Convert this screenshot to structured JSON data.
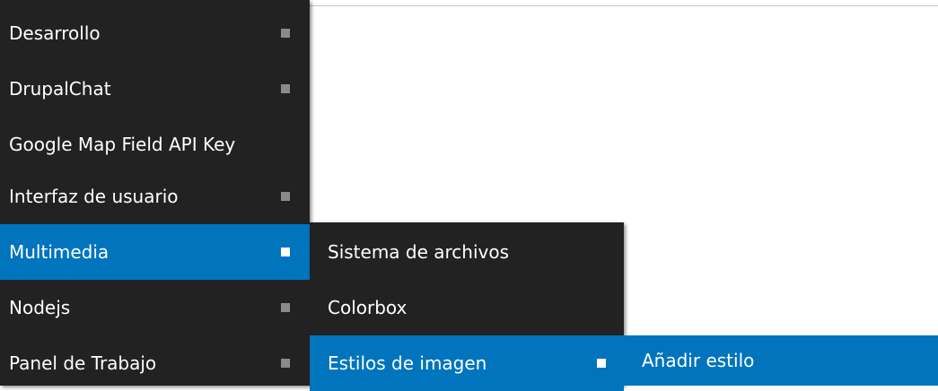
{
  "menu": {
    "level1": [
      {
        "label": "Desarrollo",
        "has_submenu": true,
        "active": false
      },
      {
        "label": "DrupalChat",
        "has_submenu": true,
        "active": false
      },
      {
        "label": "Google Map Field API Key",
        "has_submenu": false,
        "active": false
      },
      {
        "label": "Interfaz de usuario",
        "has_submenu": true,
        "active": false
      },
      {
        "label": "Multimedia",
        "has_submenu": true,
        "active": true
      },
      {
        "label": "Nodejs",
        "has_submenu": true,
        "active": false
      },
      {
        "label": "Panel de Trabajo",
        "has_submenu": true,
        "active": false
      }
    ],
    "level2": [
      {
        "label": "Sistema de archivos",
        "has_submenu": false,
        "active": false
      },
      {
        "label": "Colorbox",
        "has_submenu": false,
        "active": false
      },
      {
        "label": "Estilos de imagen",
        "has_submenu": true,
        "active": true
      }
    ],
    "level3": [
      {
        "label": "Añadir estilo",
        "has_submenu": false,
        "active": true
      }
    ]
  },
  "colors": {
    "menu_background": "#222222",
    "active_background": "#0074bd",
    "submenu_marker": "#8a8a8a",
    "active_marker": "#ffffff",
    "text": "#ffffff"
  }
}
